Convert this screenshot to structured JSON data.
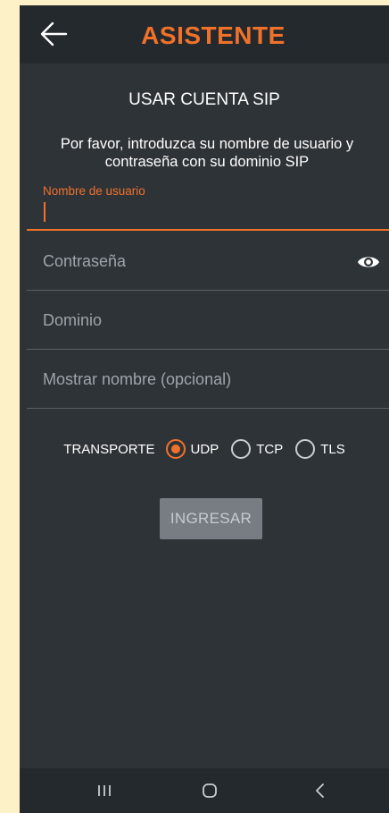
{
  "header": {
    "title": "ASISTENTE",
    "back_icon": "arrow-left-icon"
  },
  "form": {
    "section_title": "USAR CUENTA SIP",
    "instructions": "Por favor, introduzca su nombre de usuario y contraseña con su dominio SIP",
    "username": {
      "label": "Nombre de usuario",
      "value": ""
    },
    "password": {
      "placeholder": "Contraseña",
      "toggle_icon": "eye-icon"
    },
    "domain": {
      "placeholder": "Dominio"
    },
    "display_name": {
      "placeholder": "Mostrar nombre (opcional)"
    },
    "transport": {
      "label": "TRANSPORTE",
      "options": [
        {
          "label": "UDP",
          "selected": true
        },
        {
          "label": "TCP",
          "selected": false
        },
        {
          "label": "TLS",
          "selected": false
        }
      ]
    },
    "submit_label": "INGRESAR"
  },
  "system_nav": {
    "recents_icon": "recent-apps-icon",
    "home_icon": "home-icon",
    "back_icon": "back-chevron-icon"
  },
  "colors": {
    "accent": "#f0722a",
    "background": "#2e3338",
    "toolbar": "#24292e",
    "button_disabled": "#777d83",
    "outer_background": "#fdf1c7"
  }
}
